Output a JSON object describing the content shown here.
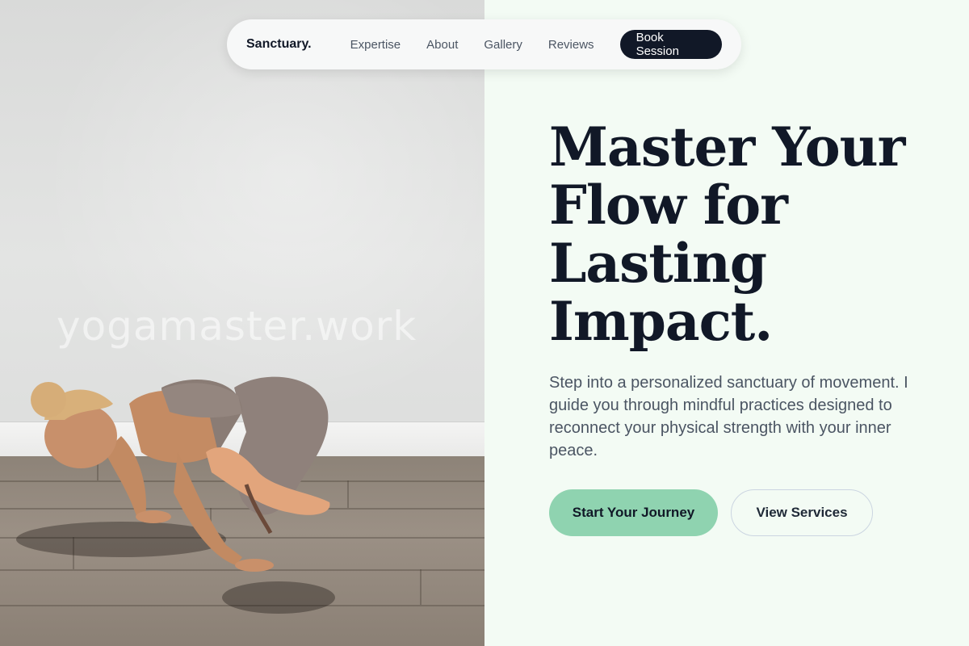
{
  "nav": {
    "brand": "Sanctuary.",
    "links": [
      "Expertise",
      "About",
      "Gallery",
      "Reviews"
    ],
    "cta": "Book Session"
  },
  "hero": {
    "headline": "Master Your Flow for Lasting Impact.",
    "body": "Step into a personalized sanctuary of movement. I guide you through mindful practices designed to reconnect your physical strength with your inner peace.",
    "primary_cta": "Start Your Journey",
    "secondary_cta": "View Services"
  },
  "image": {
    "watermark": "yogamaster.work",
    "subject": "yoga-practitioner-arm-balance"
  },
  "colors": {
    "primary": "#111827",
    "accent": "#8fd3b0",
    "background": "#f3fbf4"
  }
}
